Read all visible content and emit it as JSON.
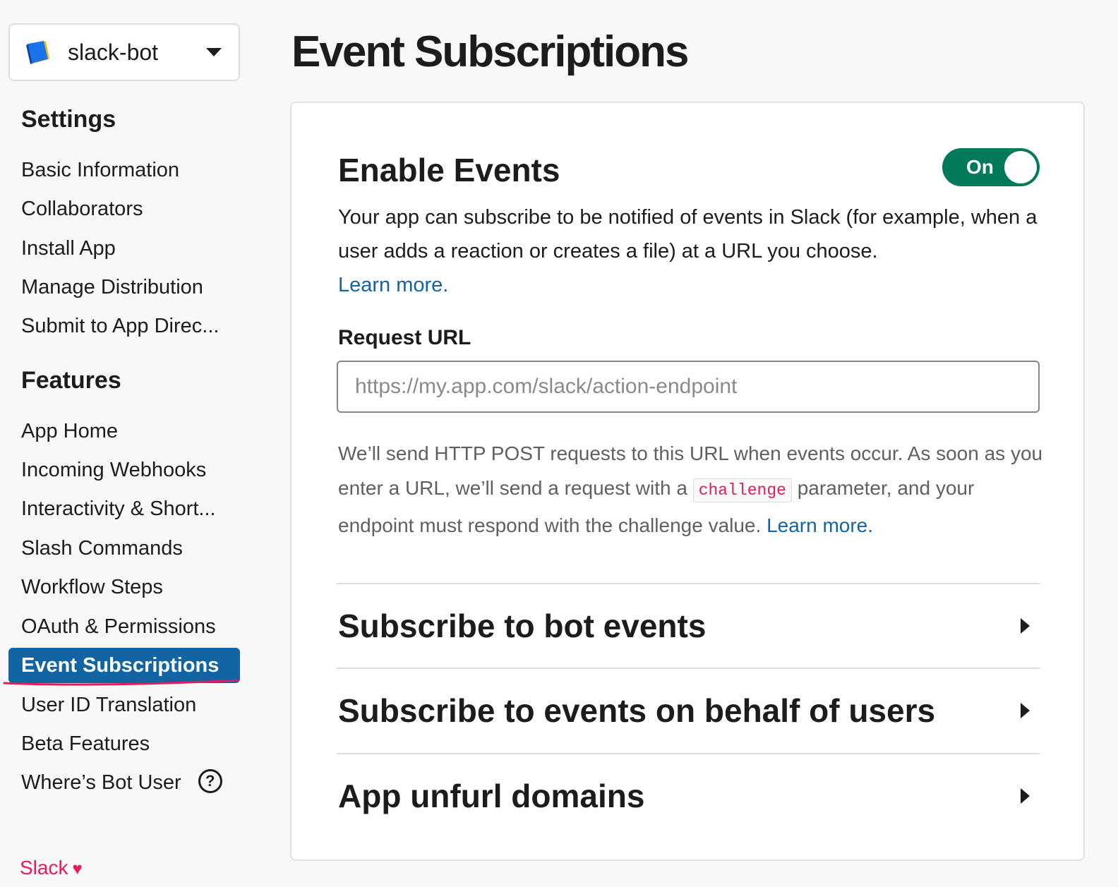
{
  "app": {
    "name": "slack-bot"
  },
  "sidebar": {
    "settings_heading": "Settings",
    "settings_items": [
      {
        "label": "Basic Information"
      },
      {
        "label": "Collaborators"
      },
      {
        "label": "Install App"
      },
      {
        "label": "Manage Distribution"
      },
      {
        "label": "Submit to App Direc..."
      }
    ],
    "features_heading": "Features",
    "features_items": [
      {
        "label": "App Home"
      },
      {
        "label": "Incoming Webhooks"
      },
      {
        "label": "Interactivity & Short..."
      },
      {
        "label": "Slash Commands"
      },
      {
        "label": "Workflow Steps"
      },
      {
        "label": "OAuth & Permissions"
      },
      {
        "label": "Event Subscriptions",
        "active": true
      },
      {
        "label": "User ID Translation"
      },
      {
        "label": "Beta Features"
      },
      {
        "label": "Where’s Bot User",
        "help_icon": "question-circle-icon",
        "help_glyph": "?"
      }
    ],
    "footer": {
      "label": "Slack",
      "icon": "heart-icon",
      "glyph": "♥"
    }
  },
  "main": {
    "page_title": "Event Subscriptions",
    "enable_events": {
      "title": "Enable Events",
      "toggle_label": "On",
      "toggle_on": true,
      "description": "Your app can subscribe to be notified of events in Slack (for example, when a user adds a reaction or creates a file) at a URL you choose.",
      "learn_more": "Learn more."
    },
    "request_url": {
      "label": "Request URL",
      "value": "",
      "placeholder": "https://my.app.com/slack/action-endpoint",
      "help_part1": "We’ll send HTTP POST requests to this URL when events occur. As soon as you enter a URL, we’ll send a request with a",
      "help_code": "challenge",
      "help_part2": "parameter, and your endpoint must respond with the challenge value.",
      "help_link": "Learn more."
    },
    "sections": [
      {
        "label": "Subscribe to bot events"
      },
      {
        "label": "Subscribe to events on behalf of users"
      },
      {
        "label": "App unfurl domains"
      }
    ]
  },
  "colors": {
    "accent": "#1264a3",
    "toggle_on": "#007a5a",
    "annotation": "#e01e5a",
    "code": "#e01e5a"
  }
}
